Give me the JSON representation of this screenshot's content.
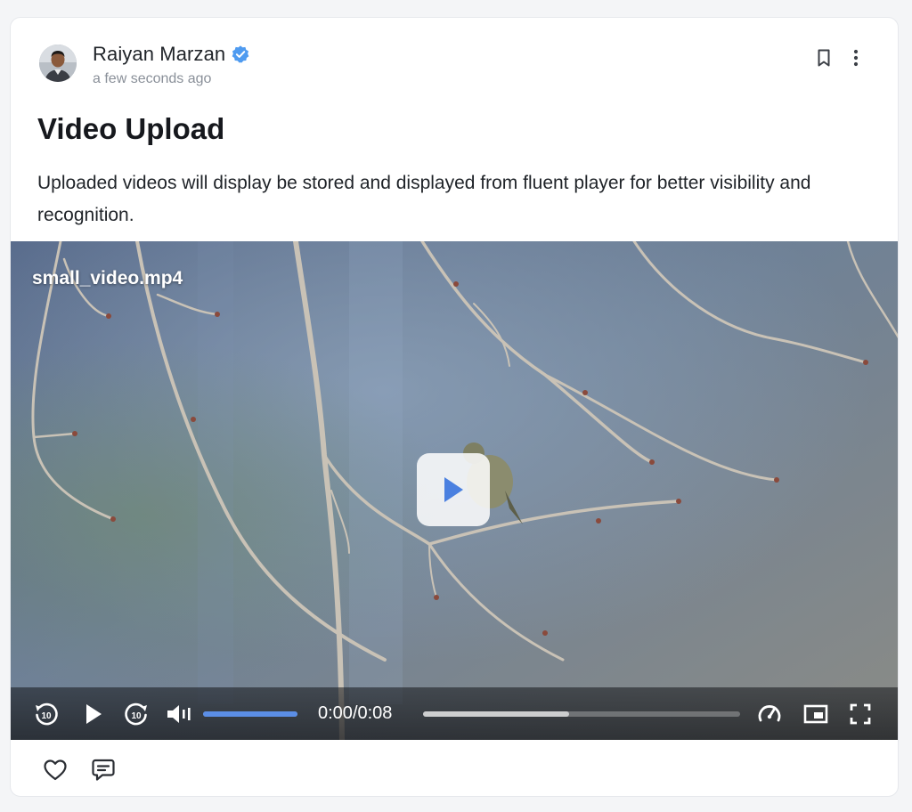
{
  "post": {
    "author": {
      "name": "Raiyan Marzan",
      "verified": true,
      "verified_color": "#4f9bf0",
      "avatar_icon": "avatar"
    },
    "timestamp": "a few seconds ago",
    "title": "Video Upload",
    "body": "Uploaded videos will display be stored and displayed from fluent player for better visibility and recognition.",
    "actions": {
      "bookmark_icon": "bookmark-icon",
      "more_icon": "more-vertical-icon"
    }
  },
  "video": {
    "filename": "small_video.mp4",
    "current_time": "0:00",
    "separator": "/",
    "duration": "0:08",
    "volume_fraction": 1.0,
    "buffered_fraction": 0.46,
    "played_fraction": 0.0,
    "accent_color": "#5b8ee6",
    "controls": [
      "rewind-10-icon",
      "play-icon",
      "forward-10-icon",
      "volume-icon",
      "speed-icon",
      "picture-in-picture-icon",
      "fullscreen-icon"
    ]
  },
  "footer": {
    "icons": [
      "heart-icon",
      "comment-icon"
    ]
  }
}
